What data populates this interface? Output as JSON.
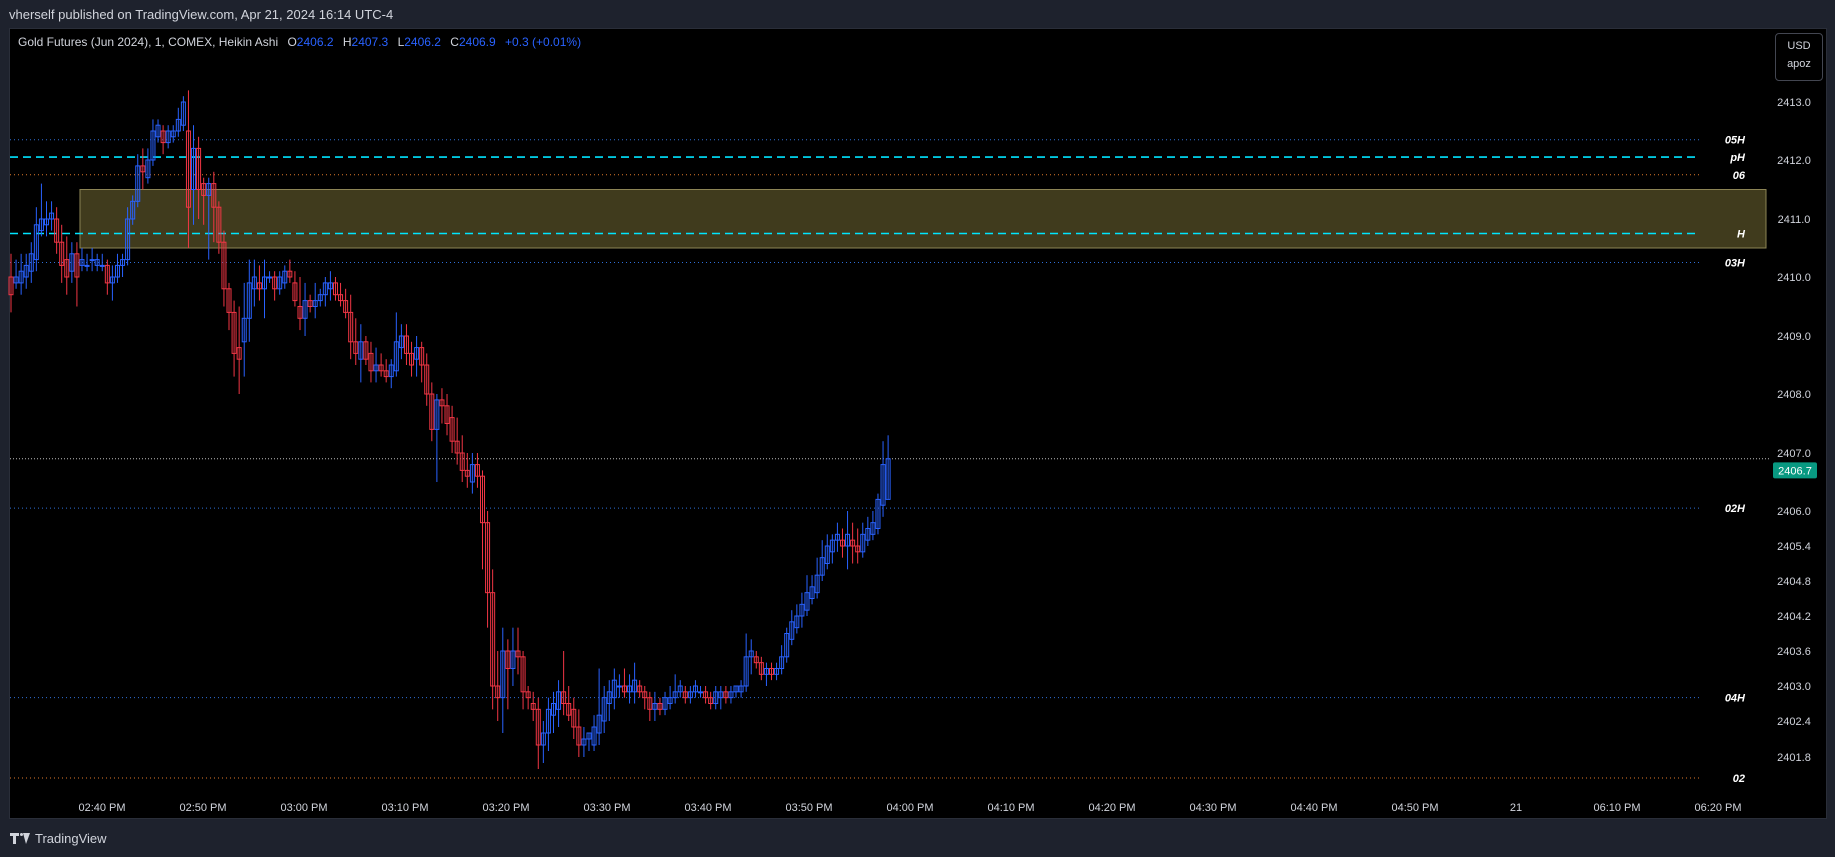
{
  "header": {
    "published": "vherself published on TradingView.com, Apr 21, 2024 16:14 UTC-4"
  },
  "legend": {
    "symbol": "Gold Futures (Jun 2024), 1, COMEX, Heikin Ashi",
    "o_label": "O",
    "o_value": "2406.2",
    "h_label": "H",
    "h_value": "2407.3",
    "l_label": "L",
    "l_value": "2406.2",
    "c_label": "C",
    "c_value": "2406.9",
    "change": "+0.3 (+0.01%)"
  },
  "unit_box": {
    "currency": "USD",
    "unit": "apoz"
  },
  "footer": {
    "logo_text": "TradingView"
  },
  "colors": {
    "up": "#2962ff",
    "down": "#f23645",
    "zone": "#6b6331",
    "cyan": "#00e5ff",
    "orange": "#e07a2b",
    "blue_dotted": "#2f6fd6",
    "price_badge": "#089981"
  },
  "chart_data": {
    "type": "candlestick",
    "style": "Heikin Ashi",
    "ylim": [
      2401.4,
      2413.45
    ],
    "y_ticks": [
      "2413.0",
      "2412.0",
      "2411.0",
      "2410.0",
      "2409.0",
      "2408.0",
      "2407.0",
      "2406.0",
      "2405.4",
      "2404.8",
      "2404.2",
      "2403.6",
      "2403.0",
      "2402.4",
      "2401.8"
    ],
    "x_ticks": [
      "02:40 PM",
      "02:50 PM",
      "03:00 PM",
      "03:10 PM",
      "03:20 PM",
      "03:30 PM",
      "03:40 PM",
      "03:50 PM",
      "04:00 PM",
      "04:10 PM",
      "04:20 PM",
      "04:30 PM",
      "04:40 PM",
      "04:50 PM",
      "21",
      "06:10 PM",
      "06:20 PM"
    ],
    "last_price": "2406.7",
    "levels": [
      {
        "label": "05H",
        "price": 2412.35,
        "style": "dotted",
        "color": "#2f6fd6"
      },
      {
        "label": "pH",
        "price": 2412.05,
        "style": "dashed",
        "color": "#00e5ff"
      },
      {
        "label": "06",
        "price": 2411.75,
        "style": "dotted",
        "color": "#e07a2b"
      },
      {
        "label": "H",
        "price": 2410.75,
        "style": "dashed",
        "color": "#00e5ff"
      },
      {
        "label": "03H",
        "price": 2410.25,
        "style": "dotted",
        "color": "#2f6fd6"
      },
      {
        "label": "02H",
        "price": 2406.05,
        "style": "dotted",
        "color": "#2f6fd6"
      },
      {
        "label": "04H",
        "price": 2402.8,
        "style": "dotted",
        "color": "#2f6fd6"
      },
      {
        "label": "02",
        "price": 2401.45,
        "style": "dotted",
        "color": "#e07a2b"
      }
    ],
    "last_price_line": 2406.9,
    "zone": {
      "top": 2411.5,
      "bottom": 2410.5,
      "start_index": 14
    },
    "candles": [
      {
        "o": 2410.0,
        "h": 2410.4,
        "l": 2409.4,
        "c": 2409.7
      },
      {
        "o": 2409.9,
        "h": 2410.3,
        "l": 2409.8,
        "c": 2410.0
      },
      {
        "o": 2409.9,
        "h": 2410.4,
        "l": 2409.7,
        "c": 2410.1
      },
      {
        "o": 2410.0,
        "h": 2410.4,
        "l": 2409.8,
        "c": 2410.2
      },
      {
        "o": 2410.1,
        "h": 2410.6,
        "l": 2409.9,
        "c": 2410.4
      },
      {
        "o": 2410.3,
        "h": 2411.2,
        "l": 2410.1,
        "c": 2410.9
      },
      {
        "o": 2410.8,
        "h": 2411.6,
        "l": 2410.7,
        "c": 2411.0
      },
      {
        "o": 2410.9,
        "h": 2411.3,
        "l": 2410.7,
        "c": 2411.0
      },
      {
        "o": 2411.0,
        "h": 2411.3,
        "l": 2410.8,
        "c": 2411.1
      },
      {
        "o": 2411.0,
        "h": 2411.2,
        "l": 2410.4,
        "c": 2410.6
      },
      {
        "o": 2410.6,
        "h": 2410.9,
        "l": 2409.9,
        "c": 2410.2
      },
      {
        "o": 2410.3,
        "h": 2410.7,
        "l": 2409.7,
        "c": 2410.0
      },
      {
        "o": 2410.1,
        "h": 2410.6,
        "l": 2409.9,
        "c": 2410.4
      },
      {
        "o": 2410.4,
        "h": 2410.6,
        "l": 2409.5,
        "c": 2410.0
      },
      {
        "o": 2410.2,
        "h": 2410.5,
        "l": 2410.1,
        "c": 2410.3
      },
      {
        "o": 2410.2,
        "h": 2410.4,
        "l": 2410.1,
        "c": 2410.2
      },
      {
        "o": 2410.3,
        "h": 2410.5,
        "l": 2410.1,
        "c": 2410.3
      },
      {
        "o": 2410.2,
        "h": 2410.4,
        "l": 2410.1,
        "c": 2410.3
      },
      {
        "o": 2410.2,
        "h": 2410.4,
        "l": 2410.1,
        "c": 2410.2
      },
      {
        "o": 2410.2,
        "h": 2410.3,
        "l": 2409.7,
        "c": 2409.9
      },
      {
        "o": 2409.9,
        "h": 2410.2,
        "l": 2409.6,
        "c": 2410.0
      },
      {
        "o": 2410.0,
        "h": 2410.4,
        "l": 2409.9,
        "c": 2410.2
      },
      {
        "o": 2410.2,
        "h": 2410.4,
        "l": 2410.0,
        "c": 2410.3
      },
      {
        "o": 2410.3,
        "h": 2411.2,
        "l": 2410.2,
        "c": 2411.0
      },
      {
        "o": 2411.0,
        "h": 2411.4,
        "l": 2410.9,
        "c": 2411.3
      },
      {
        "o": 2411.3,
        "h": 2412.1,
        "l": 2411.2,
        "c": 2411.9
      },
      {
        "o": 2411.9,
        "h": 2412.2,
        "l": 2411.5,
        "c": 2411.8
      },
      {
        "o": 2411.7,
        "h": 2412.2,
        "l": 2411.6,
        "c": 2412.0
      },
      {
        "o": 2412.0,
        "h": 2412.7,
        "l": 2411.9,
        "c": 2412.5
      },
      {
        "o": 2412.4,
        "h": 2412.7,
        "l": 2412.3,
        "c": 2412.6
      },
      {
        "o": 2412.5,
        "h": 2412.6,
        "l": 2412.1,
        "c": 2412.3
      },
      {
        "o": 2412.3,
        "h": 2412.6,
        "l": 2412.2,
        "c": 2412.5
      },
      {
        "o": 2412.4,
        "h": 2412.6,
        "l": 2412.3,
        "c": 2412.5
      },
      {
        "o": 2412.5,
        "h": 2412.9,
        "l": 2412.4,
        "c": 2412.7
      },
      {
        "o": 2412.6,
        "h": 2413.1,
        "l": 2412.5,
        "c": 2413.0
      },
      {
        "o": 2412.5,
        "h": 2413.2,
        "l": 2410.5,
        "c": 2411.2
      },
      {
        "o": 2411.5,
        "h": 2412.6,
        "l": 2410.9,
        "c": 2412.2
      },
      {
        "o": 2412.2,
        "h": 2412.4,
        "l": 2411.0,
        "c": 2411.5
      },
      {
        "o": 2411.6,
        "h": 2411.7,
        "l": 2410.9,
        "c": 2411.4
      },
      {
        "o": 2411.4,
        "h": 2411.7,
        "l": 2410.3,
        "c": 2411.6
      },
      {
        "o": 2411.6,
        "h": 2411.8,
        "l": 2410.6,
        "c": 2411.2
      },
      {
        "o": 2411.2,
        "h": 2411.3,
        "l": 2410.4,
        "c": 2410.6
      },
      {
        "o": 2410.6,
        "h": 2410.8,
        "l": 2409.5,
        "c": 2409.8
      },
      {
        "o": 2409.8,
        "h": 2409.9,
        "l": 2409.1,
        "c": 2409.4
      },
      {
        "o": 2409.4,
        "h": 2409.6,
        "l": 2408.3,
        "c": 2408.7
      },
      {
        "o": 2408.8,
        "h": 2409.5,
        "l": 2408.0,
        "c": 2408.6
      },
      {
        "o": 2408.9,
        "h": 2409.9,
        "l": 2408.3,
        "c": 2409.3
      },
      {
        "o": 2409.3,
        "h": 2410.3,
        "l": 2408.9,
        "c": 2409.9
      },
      {
        "o": 2409.8,
        "h": 2410.3,
        "l": 2409.5,
        "c": 2410.0
      },
      {
        "o": 2409.9,
        "h": 2410.2,
        "l": 2409.6,
        "c": 2409.8
      },
      {
        "o": 2409.8,
        "h": 2410.3,
        "l": 2409.3,
        "c": 2410.0
      },
      {
        "o": 2410.0,
        "h": 2410.1,
        "l": 2409.9,
        "c": 2410.0
      },
      {
        "o": 2410.0,
        "h": 2410.1,
        "l": 2409.6,
        "c": 2409.8
      },
      {
        "o": 2409.8,
        "h": 2410.1,
        "l": 2409.7,
        "c": 2410.0
      },
      {
        "o": 2409.9,
        "h": 2410.2,
        "l": 2409.8,
        "c": 2410.1
      },
      {
        "o": 2410.1,
        "h": 2410.3,
        "l": 2409.9,
        "c": 2410.0
      },
      {
        "o": 2409.9,
        "h": 2410.1,
        "l": 2409.5,
        "c": 2409.6
      },
      {
        "o": 2409.5,
        "h": 2410.0,
        "l": 2409.1,
        "c": 2409.3
      },
      {
        "o": 2409.3,
        "h": 2409.9,
        "l": 2409.0,
        "c": 2409.6
      },
      {
        "o": 2409.6,
        "h": 2409.7,
        "l": 2409.4,
        "c": 2409.5
      },
      {
        "o": 2409.5,
        "h": 2409.9,
        "l": 2409.3,
        "c": 2409.6
      },
      {
        "o": 2409.6,
        "h": 2409.8,
        "l": 2409.5,
        "c": 2409.7
      },
      {
        "o": 2409.7,
        "h": 2410.0,
        "l": 2409.5,
        "c": 2409.9
      },
      {
        "o": 2409.8,
        "h": 2410.1,
        "l": 2409.6,
        "c": 2409.9
      },
      {
        "o": 2409.9,
        "h": 2410.0,
        "l": 2409.6,
        "c": 2409.7
      },
      {
        "o": 2409.7,
        "h": 2409.9,
        "l": 2409.5,
        "c": 2409.6
      },
      {
        "o": 2409.6,
        "h": 2409.8,
        "l": 2409.3,
        "c": 2409.4
      },
      {
        "o": 2409.4,
        "h": 2409.7,
        "l": 2408.6,
        "c": 2408.9
      },
      {
        "o": 2408.9,
        "h": 2409.3,
        "l": 2408.5,
        "c": 2408.7
      },
      {
        "o": 2408.6,
        "h": 2409.2,
        "l": 2408.2,
        "c": 2408.9
      },
      {
        "o": 2408.9,
        "h": 2409.0,
        "l": 2408.5,
        "c": 2408.6
      },
      {
        "o": 2408.7,
        "h": 2408.9,
        "l": 2408.2,
        "c": 2408.4
      },
      {
        "o": 2408.4,
        "h": 2408.8,
        "l": 2408.2,
        "c": 2408.5
      },
      {
        "o": 2408.5,
        "h": 2408.7,
        "l": 2408.3,
        "c": 2408.4
      },
      {
        "o": 2408.4,
        "h": 2408.6,
        "l": 2408.2,
        "c": 2408.3
      },
      {
        "o": 2408.3,
        "h": 2408.6,
        "l": 2408.1,
        "c": 2408.5
      },
      {
        "o": 2408.4,
        "h": 2409.4,
        "l": 2408.3,
        "c": 2408.9
      },
      {
        "o": 2408.8,
        "h": 2409.2,
        "l": 2408.6,
        "c": 2409.0
      },
      {
        "o": 2409.0,
        "h": 2409.2,
        "l": 2408.5,
        "c": 2408.7
      },
      {
        "o": 2408.7,
        "h": 2408.9,
        "l": 2408.3,
        "c": 2408.5
      },
      {
        "o": 2408.6,
        "h": 2409.0,
        "l": 2408.3,
        "c": 2408.8
      },
      {
        "o": 2408.8,
        "h": 2408.9,
        "l": 2408.2,
        "c": 2408.5
      },
      {
        "o": 2408.5,
        "h": 2408.7,
        "l": 2407.8,
        "c": 2408.0
      },
      {
        "o": 2408.0,
        "h": 2408.2,
        "l": 2407.2,
        "c": 2407.4
      },
      {
        "o": 2407.4,
        "h": 2408.0,
        "l": 2406.5,
        "c": 2407.9
      },
      {
        "o": 2407.9,
        "h": 2408.1,
        "l": 2407.5,
        "c": 2407.8
      },
      {
        "o": 2407.8,
        "h": 2408.0,
        "l": 2407.3,
        "c": 2407.5
      },
      {
        "o": 2407.6,
        "h": 2407.8,
        "l": 2407.0,
        "c": 2407.2
      },
      {
        "o": 2407.2,
        "h": 2407.6,
        "l": 2406.8,
        "c": 2407.0
      },
      {
        "o": 2407.0,
        "h": 2407.3,
        "l": 2406.5,
        "c": 2406.7
      },
      {
        "o": 2406.7,
        "h": 2407.0,
        "l": 2406.4,
        "c": 2406.6
      },
      {
        "o": 2406.5,
        "h": 2407.0,
        "l": 2406.3,
        "c": 2406.8
      },
      {
        "o": 2406.8,
        "h": 2407.0,
        "l": 2406.4,
        "c": 2406.6
      },
      {
        "o": 2406.6,
        "h": 2406.7,
        "l": 2405.0,
        "c": 2405.8
      },
      {
        "o": 2405.8,
        "h": 2406.0,
        "l": 2404.0,
        "c": 2404.6
      },
      {
        "o": 2404.6,
        "h": 2405.0,
        "l": 2402.6,
        "c": 2403.0
      },
      {
        "o": 2403.0,
        "h": 2403.6,
        "l": 2402.4,
        "c": 2402.8
      },
      {
        "o": 2402.8,
        "h": 2404.0,
        "l": 2402.2,
        "c": 2403.6
      },
      {
        "o": 2403.6,
        "h": 2403.8,
        "l": 2402.6,
        "c": 2403.3
      },
      {
        "o": 2403.3,
        "h": 2404.0,
        "l": 2403.0,
        "c": 2403.6
      },
      {
        "o": 2403.6,
        "h": 2404.0,
        "l": 2403.2,
        "c": 2403.5
      },
      {
        "o": 2403.5,
        "h": 2403.6,
        "l": 2402.6,
        "c": 2402.9
      },
      {
        "o": 2402.9,
        "h": 2403.0,
        "l": 2402.6,
        "c": 2402.8
      },
      {
        "o": 2402.7,
        "h": 2402.9,
        "l": 2402.4,
        "c": 2402.6
      },
      {
        "o": 2402.6,
        "h": 2402.8,
        "l": 2401.6,
        "c": 2402.0
      },
      {
        "o": 2402.0,
        "h": 2402.4,
        "l": 2401.7,
        "c": 2402.2
      },
      {
        "o": 2402.2,
        "h": 2402.8,
        "l": 2401.9,
        "c": 2402.6
      },
      {
        "o": 2402.5,
        "h": 2402.9,
        "l": 2402.2,
        "c": 2402.7
      },
      {
        "o": 2402.6,
        "h": 2403.1,
        "l": 2402.3,
        "c": 2402.9
      },
      {
        "o": 2402.9,
        "h": 2403.6,
        "l": 2402.5,
        "c": 2402.7
      },
      {
        "o": 2402.7,
        "h": 2403.0,
        "l": 2402.4,
        "c": 2402.5
      },
      {
        "o": 2402.6,
        "h": 2402.8,
        "l": 2402.1,
        "c": 2402.3
      },
      {
        "o": 2402.3,
        "h": 2402.6,
        "l": 2401.8,
        "c": 2402.0
      },
      {
        "o": 2402.0,
        "h": 2402.3,
        "l": 2401.8,
        "c": 2402.1
      },
      {
        "o": 2402.1,
        "h": 2402.2,
        "l": 2401.9,
        "c": 2402.2
      },
      {
        "o": 2402.0,
        "h": 2402.5,
        "l": 2401.9,
        "c": 2402.3
      },
      {
        "o": 2402.2,
        "h": 2403.3,
        "l": 2402.0,
        "c": 2402.5
      },
      {
        "o": 2402.4,
        "h": 2403.0,
        "l": 2402.2,
        "c": 2402.8
      },
      {
        "o": 2402.7,
        "h": 2403.1,
        "l": 2402.4,
        "c": 2402.9
      },
      {
        "o": 2402.8,
        "h": 2403.3,
        "l": 2402.6,
        "c": 2403.1
      },
      {
        "o": 2403.0,
        "h": 2403.2,
        "l": 2402.8,
        "c": 2403.0
      },
      {
        "o": 2403.0,
        "h": 2403.3,
        "l": 2402.8,
        "c": 2402.9
      },
      {
        "o": 2402.9,
        "h": 2403.2,
        "l": 2402.7,
        "c": 2403.0
      },
      {
        "o": 2402.9,
        "h": 2403.4,
        "l": 2402.7,
        "c": 2403.1
      },
      {
        "o": 2403.0,
        "h": 2403.1,
        "l": 2402.8,
        "c": 2402.9
      },
      {
        "o": 2402.9,
        "h": 2403.0,
        "l": 2402.6,
        "c": 2402.8
      },
      {
        "o": 2402.8,
        "h": 2402.9,
        "l": 2402.4,
        "c": 2402.6
      },
      {
        "o": 2402.6,
        "h": 2402.9,
        "l": 2402.4,
        "c": 2402.7
      },
      {
        "o": 2402.7,
        "h": 2402.8,
        "l": 2402.5,
        "c": 2402.6
      },
      {
        "o": 2402.6,
        "h": 2402.9,
        "l": 2402.5,
        "c": 2402.8
      },
      {
        "o": 2402.7,
        "h": 2403.0,
        "l": 2402.6,
        "c": 2402.8
      },
      {
        "o": 2402.8,
        "h": 2403.2,
        "l": 2402.7,
        "c": 2402.9
      },
      {
        "o": 2402.9,
        "h": 2403.1,
        "l": 2402.8,
        "c": 2403.0
      },
      {
        "o": 2402.9,
        "h": 2403.0,
        "l": 2402.7,
        "c": 2402.8
      },
      {
        "o": 2402.8,
        "h": 2403.0,
        "l": 2402.7,
        "c": 2402.9
      },
      {
        "o": 2402.9,
        "h": 2403.1,
        "l": 2402.8,
        "c": 2403.0
      },
      {
        "o": 2402.9,
        "h": 2403.0,
        "l": 2402.8,
        "c": 2402.9
      },
      {
        "o": 2402.9,
        "h": 2403.0,
        "l": 2402.7,
        "c": 2402.8
      },
      {
        "o": 2402.8,
        "h": 2402.9,
        "l": 2402.6,
        "c": 2402.7
      },
      {
        "o": 2402.7,
        "h": 2403.0,
        "l": 2402.6,
        "c": 2402.9
      },
      {
        "o": 2402.8,
        "h": 2403.0,
        "l": 2402.6,
        "c": 2402.9
      },
      {
        "o": 2402.9,
        "h": 2403.0,
        "l": 2402.7,
        "c": 2402.8
      },
      {
        "o": 2402.8,
        "h": 2403.0,
        "l": 2402.7,
        "c": 2402.9
      },
      {
        "o": 2402.9,
        "h": 2403.0,
        "l": 2402.8,
        "c": 2403.0
      },
      {
        "o": 2402.9,
        "h": 2403.1,
        "l": 2402.8,
        "c": 2403.0
      },
      {
        "o": 2403.0,
        "h": 2403.9,
        "l": 2402.9,
        "c": 2403.5
      },
      {
        "o": 2403.5,
        "h": 2403.8,
        "l": 2403.2,
        "c": 2403.6
      },
      {
        "o": 2403.5,
        "h": 2403.6,
        "l": 2403.3,
        "c": 2403.4
      },
      {
        "o": 2403.4,
        "h": 2403.5,
        "l": 2403.1,
        "c": 2403.2
      },
      {
        "o": 2403.2,
        "h": 2403.4,
        "l": 2403.0,
        "c": 2403.3
      },
      {
        "o": 2403.3,
        "h": 2403.4,
        "l": 2403.1,
        "c": 2403.2
      },
      {
        "o": 2403.2,
        "h": 2403.4,
        "l": 2403.1,
        "c": 2403.3
      },
      {
        "o": 2403.3,
        "h": 2403.7,
        "l": 2403.2,
        "c": 2403.5
      },
      {
        "o": 2403.5,
        "h": 2404.0,
        "l": 2403.4,
        "c": 2403.9
      },
      {
        "o": 2403.8,
        "h": 2404.3,
        "l": 2403.7,
        "c": 2404.1
      },
      {
        "o": 2404.0,
        "h": 2404.4,
        "l": 2403.9,
        "c": 2404.2
      },
      {
        "o": 2404.2,
        "h": 2404.6,
        "l": 2404.0,
        "c": 2404.4
      },
      {
        "o": 2404.3,
        "h": 2404.9,
        "l": 2404.2,
        "c": 2404.6
      },
      {
        "o": 2404.5,
        "h": 2404.9,
        "l": 2404.4,
        "c": 2404.7
      },
      {
        "o": 2404.6,
        "h": 2405.2,
        "l": 2404.5,
        "c": 2404.9
      },
      {
        "o": 2404.9,
        "h": 2405.5,
        "l": 2404.8,
        "c": 2405.2
      },
      {
        "o": 2405.1,
        "h": 2405.6,
        "l": 2405.0,
        "c": 2405.4
      },
      {
        "o": 2405.3,
        "h": 2405.6,
        "l": 2405.1,
        "c": 2405.5
      },
      {
        "o": 2405.5,
        "h": 2405.8,
        "l": 2405.3,
        "c": 2405.6
      },
      {
        "o": 2405.5,
        "h": 2405.7,
        "l": 2405.2,
        "c": 2405.4
      },
      {
        "o": 2405.4,
        "h": 2406.0,
        "l": 2405.0,
        "c": 2405.6
      },
      {
        "o": 2405.5,
        "h": 2405.8,
        "l": 2405.1,
        "c": 2405.4
      },
      {
        "o": 2405.4,
        "h": 2405.7,
        "l": 2405.1,
        "c": 2405.3
      },
      {
        "o": 2405.3,
        "h": 2405.8,
        "l": 2405.2,
        "c": 2405.6
      },
      {
        "o": 2405.5,
        "h": 2405.9,
        "l": 2405.4,
        "c": 2405.7
      },
      {
        "o": 2405.6,
        "h": 2406.0,
        "l": 2405.5,
        "c": 2405.8
      },
      {
        "o": 2405.7,
        "h": 2406.3,
        "l": 2405.6,
        "c": 2406.2
      },
      {
        "o": 2406.1,
        "h": 2407.2,
        "l": 2405.9,
        "c": 2406.8
      },
      {
        "o": 2406.2,
        "h": 2407.3,
        "l": 2406.2,
        "c": 2406.9
      }
    ]
  }
}
